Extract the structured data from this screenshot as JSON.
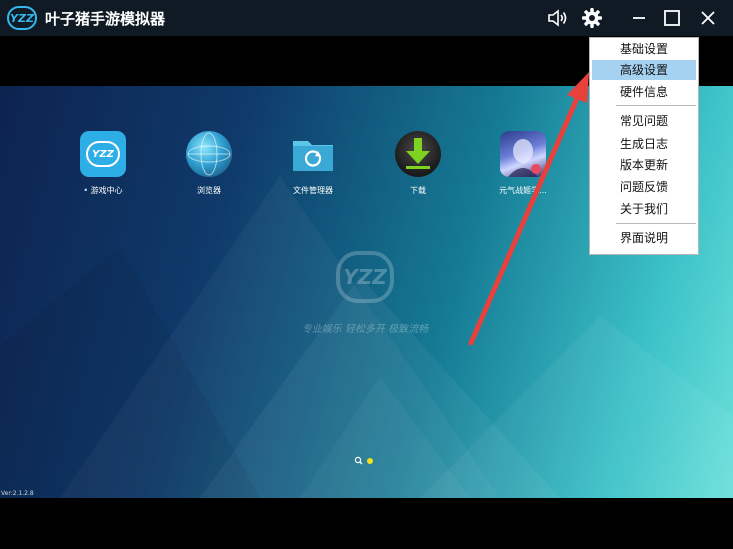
{
  "titlebar": {
    "logo_text": "YZZ",
    "title": "叶子猪手游模拟器"
  },
  "apps": [
    {
      "label": "游戏中心",
      "icon": "yzz-game-center-icon"
    },
    {
      "label": "浏览器",
      "icon": "globe-browser-icon"
    },
    {
      "label": "文件管理器",
      "icon": "folder-sync-icon"
    },
    {
      "label": "下载",
      "icon": "download-arrow-icon"
    },
    {
      "label": "元气战姬学...",
      "icon": "anime-game-icon"
    }
  ],
  "watermark": {
    "logo_text": "YZZ",
    "slogan": "专业娱乐 轻松多开 极致流畅"
  },
  "version": "Ver:2.1.2.8",
  "menu": {
    "items": [
      {
        "label": "基础设置",
        "active": false
      },
      {
        "label": "高级设置",
        "active": true
      },
      {
        "label": "硬件信息",
        "active": false
      },
      {
        "label": "常见问题",
        "active": false
      },
      {
        "label": "生成日志",
        "active": false
      },
      {
        "label": "版本更新",
        "active": false
      },
      {
        "label": "问题反馈",
        "active": false
      },
      {
        "label": "关于我们",
        "active": false
      },
      {
        "label": "界面说明",
        "active": false
      }
    ]
  },
  "colors": {
    "accent": "#37b8ec",
    "menu_highlight": "#a6d2f2",
    "annotation_arrow": "#e8413c",
    "page_dot_active": "#f3e21b"
  }
}
